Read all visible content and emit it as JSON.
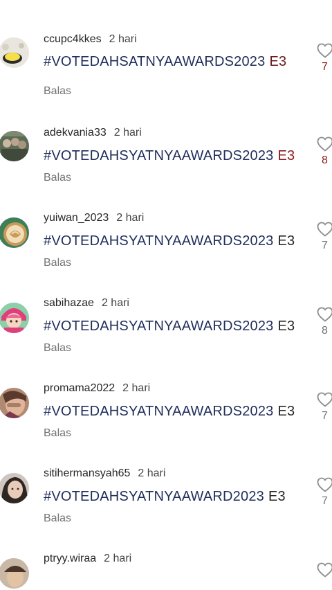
{
  "comments": [
    {
      "username": "ccupc4kkes",
      "time": "2 hari",
      "hashtag": "#VOTEDAHSATNYAAWARDS2023",
      "code": "E3",
      "code_color": "#6b1a1a",
      "reply": "Balas",
      "likes": "7",
      "avatar_icon": "bird-avatar"
    },
    {
      "username": "adekvania33",
      "time": "2 hari",
      "hashtag": "#VOTEDAHSYATNYAAWARDS2023",
      "code": "E3",
      "code_color": "#8b1a1a",
      "reply": "Balas",
      "likes": "8",
      "avatar_icon": "group-photo-avatar"
    },
    {
      "username": "yuiwan_2023",
      "time": "2 hari",
      "hashtag": "#VOTEDAHSYATNYAAWARDS2023",
      "code": "E3",
      "code_color": "#262626",
      "reply": "Balas",
      "likes": "7",
      "avatar_icon": "latte-art-avatar"
    },
    {
      "username": "sabihazae",
      "time": "2 hari",
      "hashtag": "#VOTEDAHSYATNYAAWARDS2023",
      "code": "E3",
      "code_color": "#262626",
      "reply": "Balas",
      "likes": "8",
      "avatar_icon": "cartoon-girl-avatar"
    },
    {
      "username": "promama2022",
      "time": "2 hari",
      "hashtag": "#VOTEDAHSYATNYAAWARDS2023",
      "code": "E3",
      "code_color": "#262626",
      "reply": "Balas",
      "likes": "7",
      "avatar_icon": "woman-photo-avatar"
    },
    {
      "username": "sitihermansyah65",
      "time": "2 hari",
      "hashtag": "#VOTEDAHSYATNYAAWARD2023",
      "code": "E3",
      "code_color": "#262626",
      "reply": "Balas",
      "likes": "7",
      "avatar_icon": "woman-selfie-avatar"
    },
    {
      "username": "ptryy.wiraa",
      "time": "2 hari",
      "hashtag": "",
      "code": "",
      "code_color": "#262626",
      "reply": "",
      "likes": "",
      "avatar_icon": "person-photo-avatar"
    }
  ],
  "colors": {
    "hashtag": "#1f2d5a",
    "muted": "#737373",
    "heart_outline": "#8e8e8e"
  }
}
